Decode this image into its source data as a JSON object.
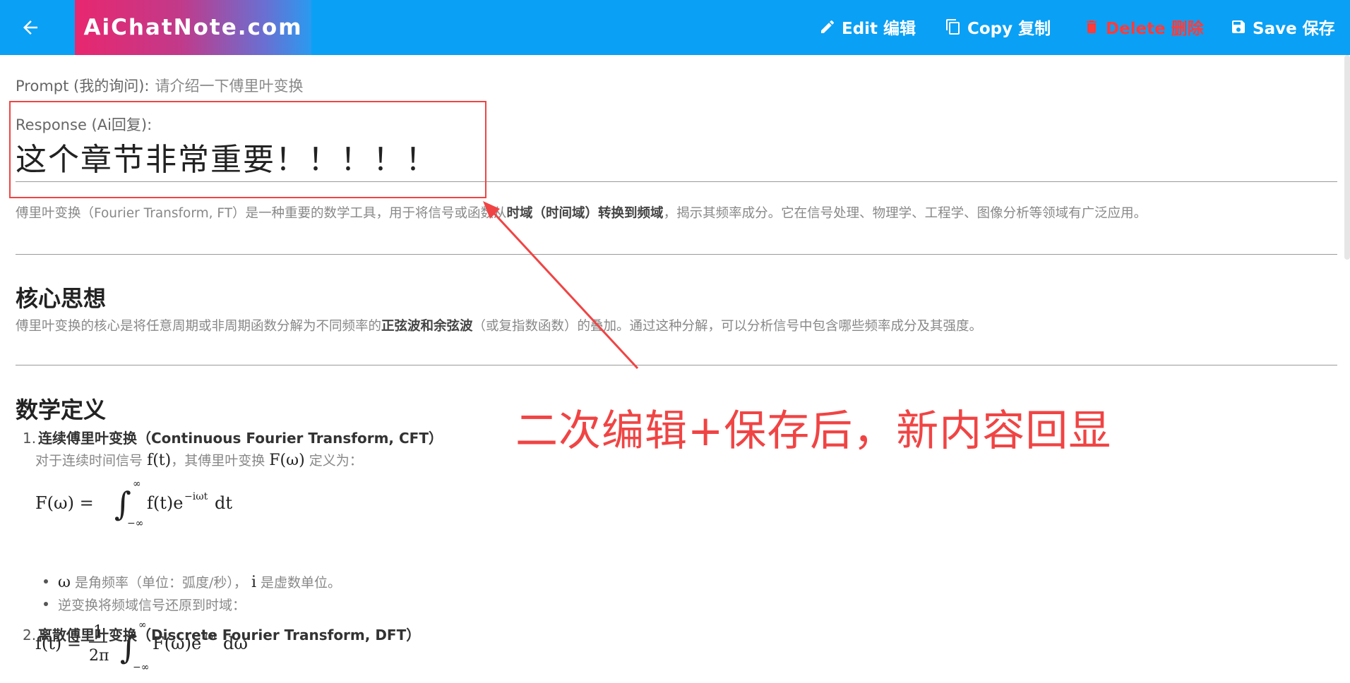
{
  "header": {
    "brand": "AiChatNote.com",
    "edit_label": "Edit 编辑",
    "copy_label": "Copy 复制",
    "delete_label": "Delete 删除",
    "save_label": "Save 保存",
    "icons": {
      "back": "arrow-left-icon",
      "edit": "pencil-icon",
      "copy": "copy-icon",
      "delete": "trash-icon",
      "save": "floppy-disk-icon"
    },
    "colors": {
      "bar": "#0aa0f5",
      "delete": "#ff3b3b"
    }
  },
  "prompt": {
    "label": "Prompt (我的询问):",
    "text": "请介绍一下傅里叶变换"
  },
  "response": {
    "label": "Response (Ai回复):",
    "title": "这个章节非常重要！！！！！",
    "intro_a": "傅里叶变换（Fourier Transform, FT）是一种重要的数学工具，用于将信号或函数从",
    "intro_b": "时域（时间域）转换到频域",
    "intro_c": "，揭示其频率成分。它在信号处理、物理学、工程学、图像分析等领域有广泛应用。"
  },
  "core": {
    "heading": "核心思想",
    "text_a": "傅里叶变换的核心是将任意周期或非周期函数分解为不同频率的",
    "text_b": "正弦波和余弦波",
    "text_c": "（或复指数函数）的叠加。通过这种分解，可以分析信号中包含哪些频率成分及其强度。"
  },
  "math": {
    "heading": "数学定义",
    "item1_num": "1.",
    "item1_title": "连续傅里叶变换（Continuous Fourier Transform, CFT）",
    "item1_desc_a": "对于连续时间信号",
    "item1_desc_var1": "f(t)",
    "item1_desc_b": "，其傅里叶变换",
    "item1_desc_var2": "F(ω)",
    "item1_desc_c": "定义为：",
    "bullet1_var1": "ω",
    "bullet1_a": "是角频率（单位：弧度/秒），",
    "bullet1_var2": "i",
    "bullet1_b": "是虚数单位。",
    "bullet2": "逆变换将频域信号还原到时域：",
    "item2_num": "2.",
    "item2_title": "离散傅里叶变换（Discrete Fourier Transform, DFT）"
  },
  "annotation": {
    "text": "二次编辑+保存后，新内容回显",
    "color": "#f04444"
  }
}
